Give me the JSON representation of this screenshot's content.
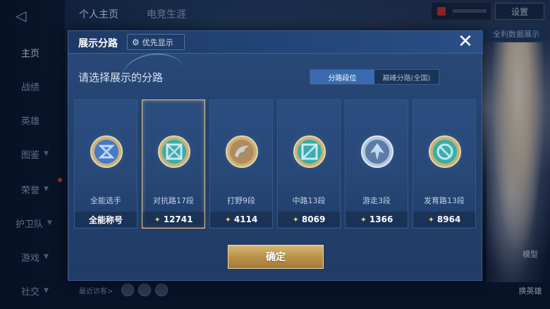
{
  "background": {
    "top_tabs": [
      "个人主页",
      "电竞生涯"
    ],
    "settings_label": "设置",
    "right_chip_text": "全利数据展示",
    "nav_items": [
      {
        "label": "主页",
        "active": true,
        "chevron": false
      },
      {
        "label": "战绩",
        "active": false,
        "chevron": false
      },
      {
        "label": "英雄",
        "active": false,
        "chevron": false
      },
      {
        "label": "图鉴",
        "active": false,
        "chevron": true
      },
      {
        "label": "荣誉",
        "active": false,
        "chevron": true
      },
      {
        "label": "护卫队",
        "active": false,
        "chevron": true
      },
      {
        "label": "游戏",
        "active": false,
        "chevron": true
      },
      {
        "label": "社交",
        "active": false,
        "chevron": true
      }
    ],
    "side_buttons": [
      "模型",
      "换英雄"
    ],
    "recent_visitors": "最近访客>"
  },
  "modal": {
    "title": "展示分路",
    "priority_label": "优先显示",
    "close_symbol": "✕",
    "subtitle": "请选择展示的分路",
    "segments": [
      {
        "label": "分路段位",
        "active": true
      },
      {
        "label": "巅峰分路(全国)",
        "active": false
      }
    ],
    "cards": [
      {
        "name": "全能选手",
        "value": "全能称号",
        "selected": false,
        "icon": "all-round-emblem-icon",
        "emblem_color": "#3f74c2",
        "show_points_icon": false
      },
      {
        "name": "对抗路17段",
        "value": "12741",
        "selected": true,
        "icon": "clash-lane-emblem-icon",
        "emblem_color": "#2fb49a",
        "show_points_icon": true
      },
      {
        "name": "打野9段",
        "value": "4114",
        "selected": false,
        "icon": "jungle-emblem-icon",
        "emblem_color": "#c58a3a",
        "show_points_icon": true
      },
      {
        "name": "中路13段",
        "value": "8069",
        "selected": false,
        "icon": "mid-lane-emblem-icon",
        "emblem_color": "#2fb49a",
        "show_points_icon": true
      },
      {
        "name": "游走3段",
        "value": "1366",
        "selected": false,
        "icon": "roam-emblem-icon",
        "emblem_color": "#8fa6c4",
        "show_points_icon": true
      },
      {
        "name": "发育路13段",
        "value": "8964",
        "selected": false,
        "icon": "farm-lane-emblem-icon",
        "emblem_color": "#2fb49a",
        "show_points_icon": true
      }
    ],
    "confirm_label": "确定"
  },
  "colors": {
    "gold_accent": "#e3c58a",
    "active_segment": "#3a6bb0",
    "teal_emblem": "#2fb49a"
  }
}
